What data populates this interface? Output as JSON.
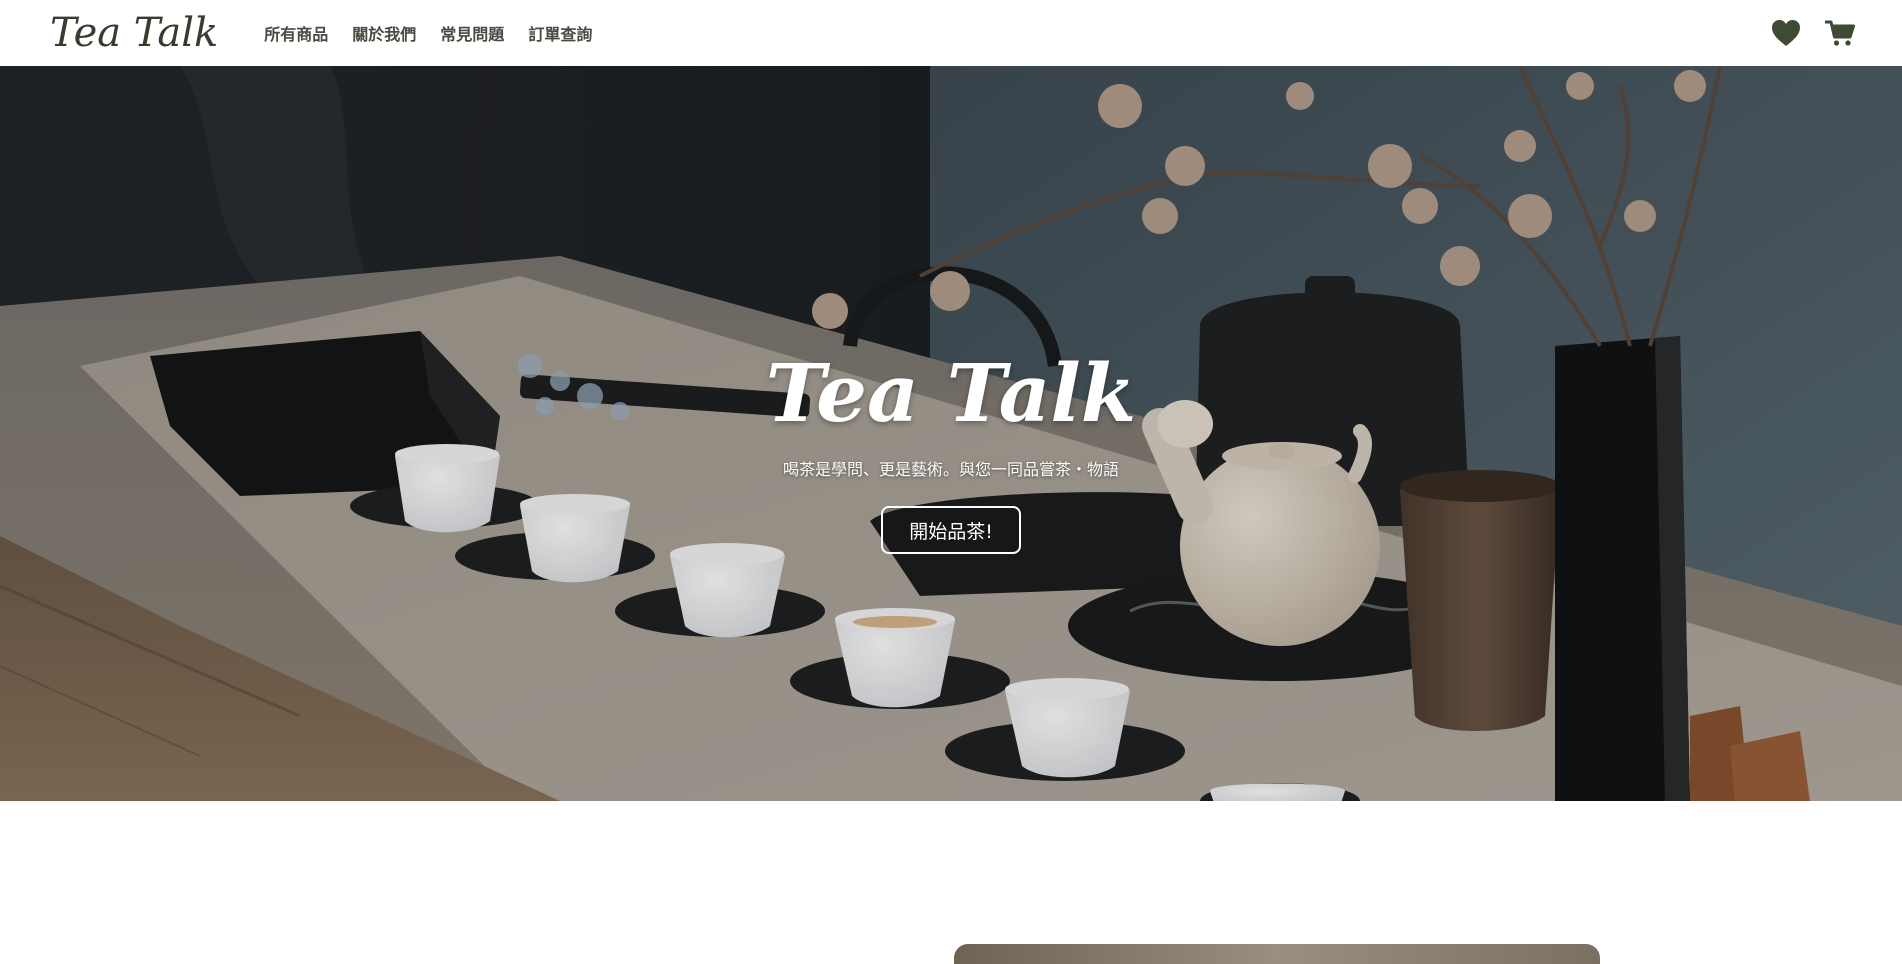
{
  "brand": {
    "logo_text": "Tea Talk"
  },
  "nav": {
    "links": [
      {
        "label": "所有商品"
      },
      {
        "label": "關於我們"
      },
      {
        "label": "常見問題"
      },
      {
        "label": "訂單查詢"
      }
    ],
    "icons": [
      "heart-icon",
      "cart-icon"
    ]
  },
  "hero": {
    "title": "Tea Talk",
    "subtitle": "喝茶是學問、更是藝術。與您一同品嘗茶・物語",
    "button_label": "開始品茶!"
  },
  "colors": {
    "nav_text": "#4a4a42",
    "icon": "#3e4a34",
    "hero_text": "#ffffff"
  }
}
